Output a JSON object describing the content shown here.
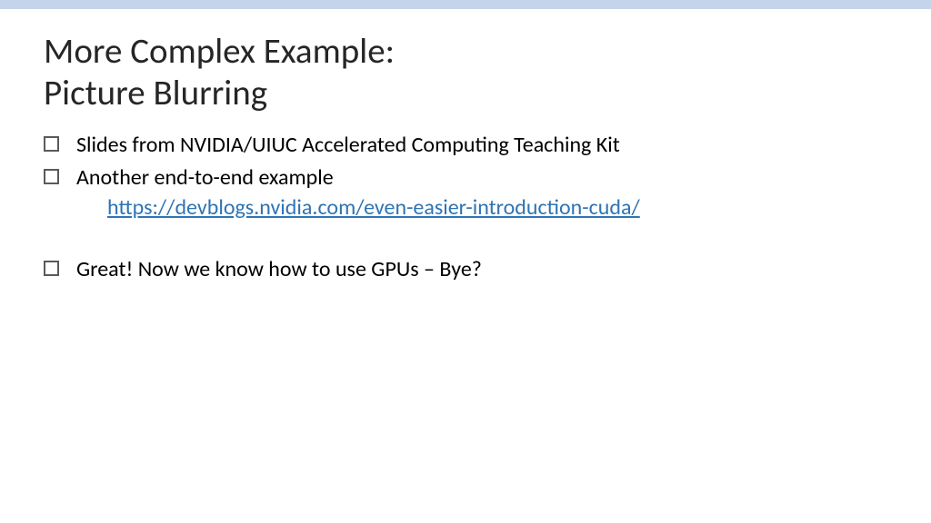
{
  "title_line1": "More Complex Example:",
  "title_line2": "Picture Blurring",
  "bullets": {
    "b1": "Slides from NVIDIA/UIUC Accelerated Computing Teaching Kit",
    "b2": "Another end-to-end example",
    "b2_link": "https://devblogs.nvidia.com/even-easier-introduction-cuda/",
    "b3": "Great! Now we know how to use GPUs – Bye?"
  }
}
